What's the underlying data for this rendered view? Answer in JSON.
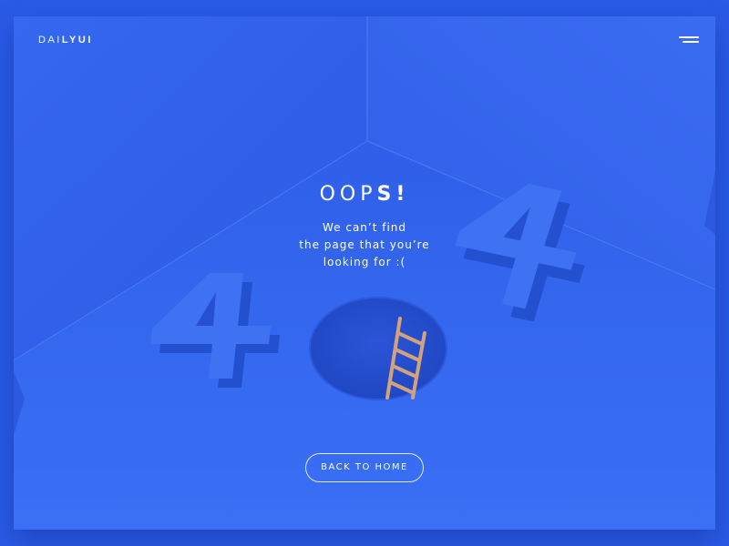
{
  "header": {
    "logo_light": "DAI",
    "logo_bold": "LYUI",
    "menu_icon": "hamburger-menu-icon"
  },
  "content": {
    "headline_thin": "OOP",
    "headline_bold": "S!",
    "message_lines": [
      "We can’t find",
      "the page that you’re",
      "looking for :("
    ],
    "button_label": "BACK TO HOME"
  },
  "illustration": {
    "digit_left": "4",
    "digit_right": "4",
    "hole_icon": "hole-icon",
    "ladder_icon": "ladder-icon"
  },
  "colors": {
    "background": "#2a5be6",
    "card": "#3566ef",
    "accent_white": "#ffffff",
    "ladder": "#d4a27a"
  }
}
